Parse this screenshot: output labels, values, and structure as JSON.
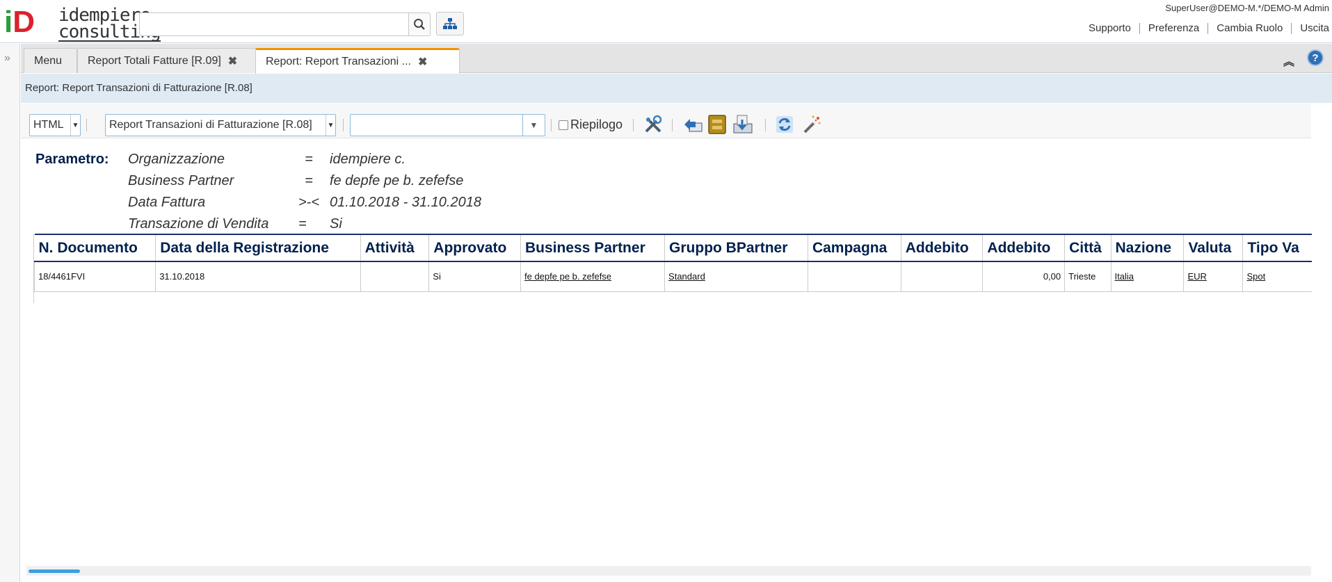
{
  "header": {
    "logo": {
      "mark": "iD",
      "line1": "idempiere",
      "line2": "consulting"
    },
    "search_placeholder": "",
    "user": "SuperUser@DEMO-M.*/DEMO-M Admin",
    "links": [
      "Supporto",
      "Preferenza",
      "Cambia Ruolo",
      "Uscita"
    ]
  },
  "tabs": [
    {
      "label": "Menu"
    },
    {
      "label": "Report Totali Fatture [R.09]"
    },
    {
      "label": "Report: Report Transazioni ..."
    }
  ],
  "title": "Report: Report Transazioni di Fatturazione [R.08]",
  "toolbar": {
    "format": "HTML",
    "report_view": "Report Transazioni di Fatturazione [R.08]",
    "print_format_value": "",
    "summary_label": "Riepilogo"
  },
  "report": {
    "param_label": "Parametro:",
    "params": [
      {
        "name": "Organizzazione",
        "op": "=",
        "value": "idempiere c."
      },
      {
        "name": "Business Partner",
        "op": "=",
        "value": "fe depfe pe b. zefefse"
      },
      {
        "name": "Data Fattura",
        "op": ">-<",
        "value": "01.10.2018 - 31.10.2018"
      },
      {
        "name": "Transazione di Vendita",
        "op": "=",
        "value": "Si"
      }
    ],
    "columns": [
      "N. Documento",
      "Data della Registrazione",
      "Attività",
      "Approvato",
      "Business Partner",
      "Gruppo BPartner",
      "Campagna",
      "Addebito",
      "Addebito",
      "Città",
      "Nazione",
      "Valuta",
      "Tipo Va"
    ],
    "rows": [
      {
        "doc": "18/4461FVI",
        "date": "31.10.2018",
        "activity": "",
        "approved": "Si",
        "bpartner": "fe depfe pe b. zefefse",
        "bp_group": "Standard",
        "campaign": "",
        "debit1": "",
        "debit2": "0,00",
        "city": "Trieste",
        "country": "Italia",
        "currency": "EUR",
        "type": "Spot"
      }
    ]
  },
  "colors": {
    "accent_tab": "#f39200",
    "title_bg": "#dfeaf3",
    "header_text": "#00204d",
    "scroll_thumb": "#3aa0df"
  }
}
